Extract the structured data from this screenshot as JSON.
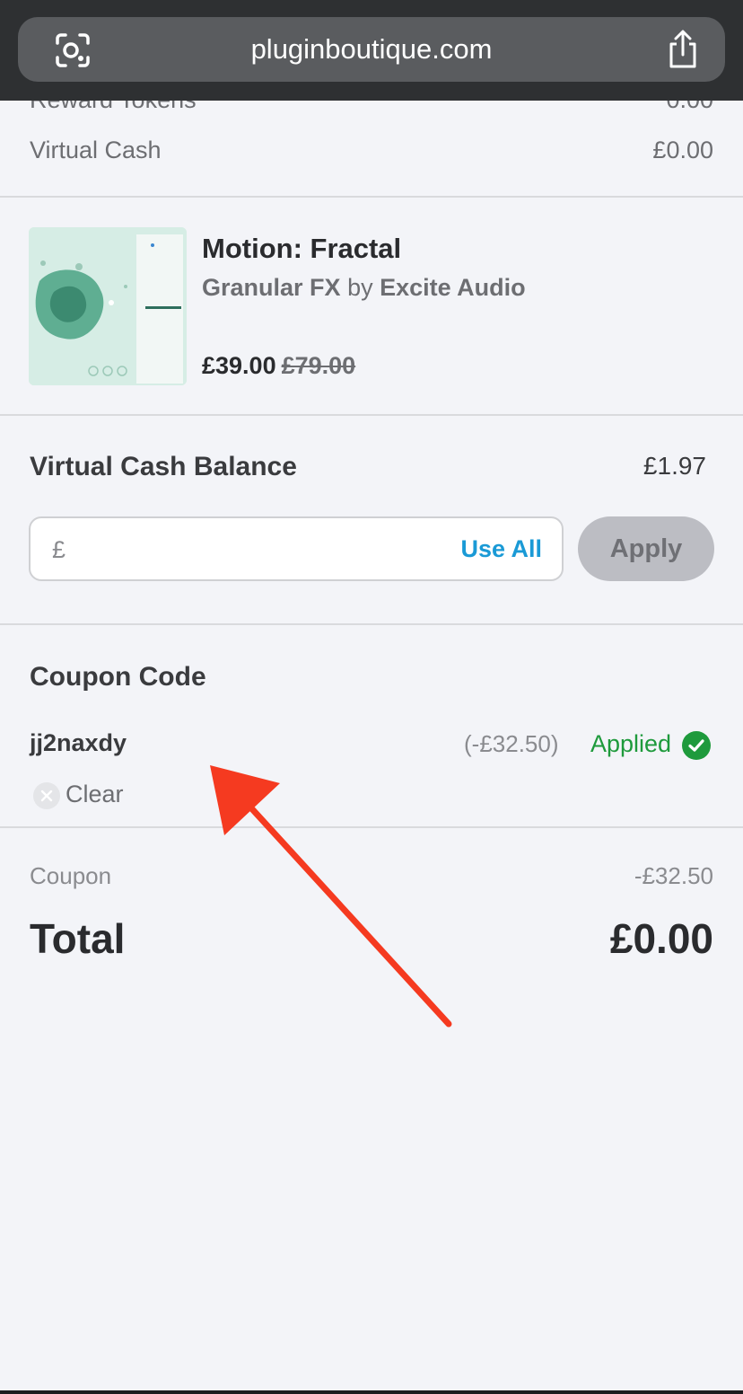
{
  "browser": {
    "url": "pluginboutique.com",
    "lens_icon": "camera-lens-icon",
    "share_icon": "share-icon"
  },
  "account": {
    "reward_tokens_label": "Reward Tokens",
    "reward_tokens_value": "0.00",
    "virtual_cash_label": "Virtual Cash",
    "virtual_cash_value": "£0.00"
  },
  "product": {
    "name": "Motion: Fractal",
    "category": "Granular FX",
    "by": "by",
    "vendor": "Excite Audio",
    "price": "£39.00",
    "old_price": "£79.00"
  },
  "virtual_cash": {
    "title": "Virtual Cash Balance",
    "balance": "£1.97",
    "currency_symbol": "£",
    "use_all_label": "Use All",
    "apply_label": "Apply"
  },
  "coupon": {
    "title": "Coupon Code",
    "code": "jj2naxdy",
    "discount": "(-£32.50)",
    "status": "Applied",
    "clear_label": "Clear"
  },
  "summary": {
    "coupon_label": "Coupon",
    "coupon_value": "-£32.50",
    "total_label": "Total",
    "total_value": "£0.00"
  },
  "colors": {
    "accent_link": "#1a9ad6",
    "applied_green": "#1e9a3c",
    "annotation_arrow": "#f53a20"
  }
}
